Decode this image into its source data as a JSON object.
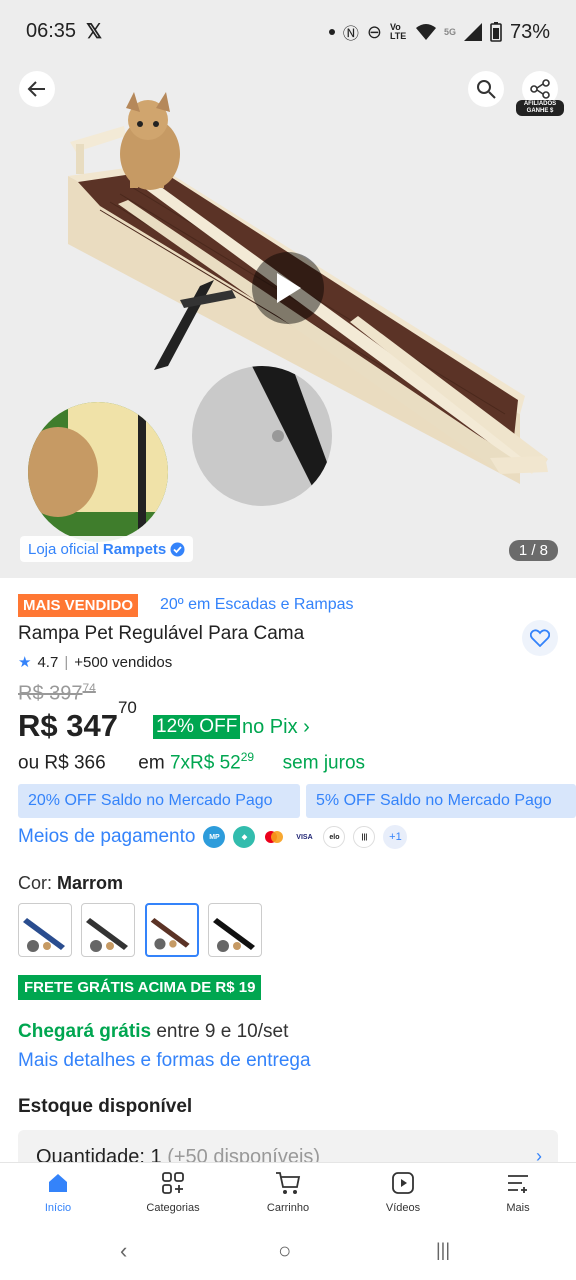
{
  "status": {
    "time": "06:35",
    "battery": "73%",
    "signal_label": "5G",
    "lte_label": "Vo LTE"
  },
  "gallery": {
    "official_prefix": "Loja oficial",
    "store_name": "Rampets",
    "counter": "1 / 8",
    "affiliate_label": "AFILIADOS GANHE $"
  },
  "product": {
    "badge_best": "MAIS VENDIDO",
    "badge_rank": "20º em Escadas e Rampas",
    "title": "Rampa Pet Regulável Para Cama",
    "rating": "4.7",
    "sold": "+500 vendidos",
    "old_price_int": "R$ 397",
    "old_price_cents": "74",
    "price_int": "R$ 347",
    "price_cents": "70",
    "off_badge": "12% OFF",
    "pix_label": "no Pix",
    "alt_price_prefix": "ou",
    "alt_price": "R$ 366",
    "inst_em": "em",
    "inst_count": "7x",
    "inst_value": "R$ 52",
    "inst_cents": "29",
    "inst_suffix": "sem juros",
    "promo_1": "20% OFF Saldo no Mercado Pago",
    "promo_2": "5% OFF Saldo no Mercado Pago",
    "payments_label": "Meios de pagamento",
    "payments_more": "+1",
    "payment_icons": [
      "mercadopago-icon",
      "pix-icon",
      "mastercard-icon",
      "visa-icon",
      "elo-icon",
      "boleto-icon"
    ],
    "color_label": "Cor:",
    "color_value": "Marrom",
    "free_shipping": "FRETE GRÁTIS ACIMA DE R$ 19",
    "arrive_bold": "Chegará grátis",
    "arrive_rest": "entre 9 e 10/set",
    "delivery_link": "Mais detalhes e formas de entrega",
    "stock_label": "Estoque disponível",
    "qty_label": "Quantidade: 1",
    "qty_avail": "(+50 disponíveis)"
  },
  "nav": {
    "items": [
      {
        "label": "Início",
        "icon": "home-icon"
      },
      {
        "label": "Categorias",
        "icon": "categories-icon"
      },
      {
        "label": "Carrinho",
        "icon": "cart-icon"
      },
      {
        "label": "Vídeos",
        "icon": "video-icon"
      },
      {
        "label": "Mais",
        "icon": "menu-icon"
      }
    ]
  },
  "colors": {
    "accent": "#3483fa",
    "green": "#00a650",
    "orange": "#ff7733"
  }
}
